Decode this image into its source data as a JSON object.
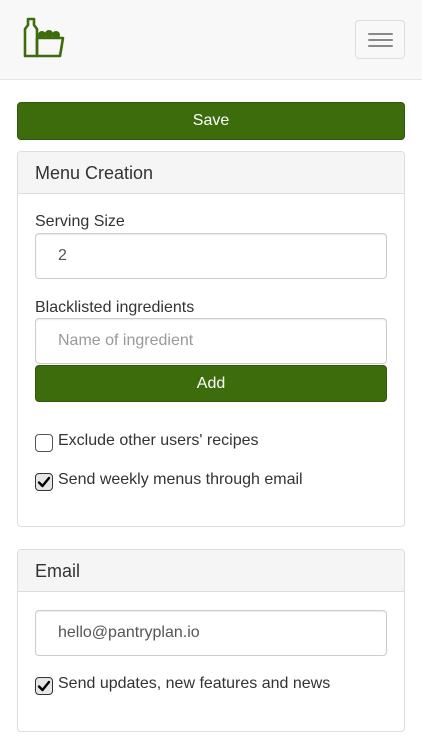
{
  "navbar": {
    "logo_icon": "pantry-logo-icon",
    "menu_icon": "hamburger-menu-icon",
    "accent": "#3c6c0c"
  },
  "save_button": {
    "label": "Save"
  },
  "menu_panel": {
    "title": "Menu Creation",
    "serving_size": {
      "label": "Serving Size",
      "value": "2"
    },
    "blacklist": {
      "label": "Blacklisted ingredients",
      "placeholder": "Name of ingredient",
      "add_label": "Add"
    },
    "exclude_others": {
      "label": "Exclude other users' recipes",
      "checked": false
    },
    "weekly_email": {
      "label": "Send weekly menus through email",
      "checked": true
    }
  },
  "email_panel": {
    "title": "Email",
    "email": {
      "value": "hello@pantryplan.io"
    },
    "updates": {
      "label": "Send updates, new features and news",
      "checked": true
    }
  }
}
